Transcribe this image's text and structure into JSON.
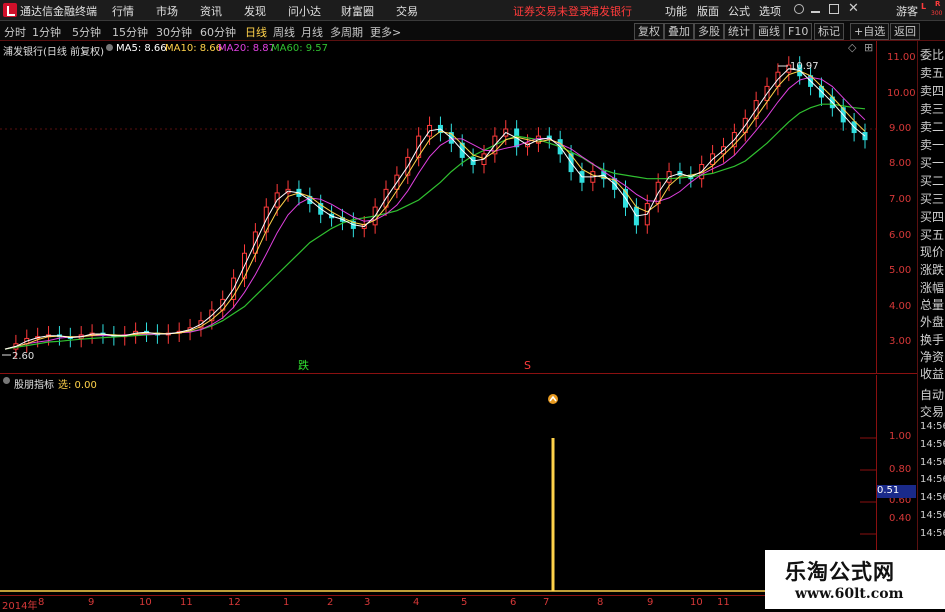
{
  "app": {
    "title": "通达信金融终端"
  },
  "menu": {
    "items": [
      "行情",
      "市场",
      "资讯",
      "发现",
      "问小达",
      "财富圈",
      "交易"
    ]
  },
  "status": {
    "not_logged": "证券交易未登录",
    "stock_name": "浦发银行"
  },
  "right_menu": {
    "items": [
      "功能",
      "版面",
      "公式",
      "选项"
    ],
    "guest": "游客"
  },
  "lr": {
    "l": "L",
    "r": "R",
    "num": "300"
  },
  "periods": {
    "items": [
      "分时",
      "1分钟",
      "5分钟",
      "15分钟",
      "30分钟",
      "60分钟",
      "日线",
      "周线",
      "月线",
      "多周期",
      "更多>"
    ],
    "active": "日线"
  },
  "toolbar": {
    "items": [
      "复权",
      "叠加",
      "多股",
      "统计",
      "画线",
      "F10",
      "标记",
      "+自选",
      "返回"
    ]
  },
  "main_legend": {
    "stock": "浦发银行(日线 前复权)",
    "ma5": "MA5: 8.66",
    "ma10": "MA10: 8.66",
    "ma20": "MA20: 8.87",
    "ma60": "MA60: 9.57"
  },
  "sub_legend": {
    "name": "股朋指标",
    "sel": "选: 0.00"
  },
  "annotations": {
    "high": "10.97",
    "low": "2.60",
    "die": "跌",
    "s": "S"
  },
  "price_axis": [
    "11.00",
    "10.00",
    "9.00",
    "8.00",
    "7.00",
    "6.00",
    "5.00",
    "4.00",
    "3.00"
  ],
  "sub_axis": [
    "1.00",
    "0.80",
    "0.60",
    "0.40"
  ],
  "sub_highlight": "0.51",
  "right_panel": [
    "委比",
    "卖五",
    "卖四",
    "卖三",
    "卖二",
    "卖一",
    "买一",
    "买二",
    "买三",
    "买四",
    "买五",
    "现价",
    "涨跌",
    "涨幅",
    "总量",
    "外盘",
    "换手",
    "净资",
    "收益",
    "自动",
    "交易",
    "14:56",
    "14:56",
    "14:56",
    "14:56",
    "14:56",
    "14:56",
    "14:56"
  ],
  "time_axis": [
    "2014年",
    "8",
    "9",
    "10",
    "11",
    "12",
    "1",
    "2",
    "3",
    "4",
    "5",
    "6",
    "7",
    "8",
    "9",
    "10",
    "11"
  ],
  "watermark": {
    "title": "乐淘公式网",
    "url": "www.60lt.com"
  },
  "colors": {
    "ma5": "#ffffff",
    "ma10": "#ffd24a",
    "ma20": "#e040e0",
    "ma60": "#30c030",
    "up": "#ff3b3b",
    "down": "#30e0e0",
    "axis": "#d63838",
    "signal": "#ffd24a"
  },
  "chart_data": {
    "type": "line",
    "price_range": [
      2.6,
      10.97
    ],
    "close": [
      2.8,
      2.95,
      3.1,
      3.15,
      3.2,
      3.15,
      3.1,
      3.2,
      3.25,
      3.2,
      3.15,
      3.2,
      3.3,
      3.25,
      3.2,
      3.25,
      3.3,
      3.4,
      3.6,
      3.9,
      4.2,
      4.8,
      5.5,
      6.1,
      6.8,
      7.2,
      7.3,
      7.1,
      6.9,
      6.6,
      6.5,
      6.4,
      6.2,
      6.3,
      6.8,
      7.3,
      7.7,
      8.2,
      8.8,
      9.1,
      8.9,
      8.6,
      8.2,
      8.0,
      8.3,
      8.8,
      9.0,
      8.5,
      8.6,
      8.8,
      8.7,
      8.3,
      7.8,
      7.5,
      7.8,
      7.6,
      7.3,
      6.8,
      6.3,
      6.9,
      7.5,
      7.8,
      7.7,
      7.6,
      8.0,
      8.3,
      8.5,
      8.9,
      9.3,
      9.8,
      10.2,
      10.6,
      10.8,
      10.5,
      10.2,
      9.9,
      9.6,
      9.2,
      8.9,
      8.7
    ],
    "ma60": [
      2.8,
      2.85,
      2.9,
      2.95,
      3.0,
      3.02,
      3.05,
      3.08,
      3.1,
      3.12,
      3.14,
      3.16,
      3.18,
      3.2,
      3.22,
      3.24,
      3.26,
      3.3,
      3.35,
      3.45,
      3.6,
      3.8,
      4.0,
      4.3,
      4.6,
      4.9,
      5.2,
      5.5,
      5.8,
      6.0,
      6.2,
      6.35,
      6.45,
      6.5,
      6.55,
      6.62,
      6.7,
      6.85,
      7.0,
      7.25,
      7.5,
      7.8,
      8.05,
      8.25,
      8.4,
      8.55,
      8.7,
      8.8,
      8.75,
      8.7,
      8.6,
      8.5,
      8.35,
      8.2,
      8.0,
      7.85,
      7.75,
      7.7,
      7.65,
      7.6,
      7.6,
      7.6,
      7.62,
      7.65,
      7.7,
      7.75,
      7.85,
      7.95,
      8.1,
      8.35,
      8.6,
      8.9,
      9.2,
      9.45,
      9.6,
      9.7,
      9.7,
      9.65,
      9.6,
      9.57
    ],
    "signal": {
      "range": [
        0,
        1.0
      ],
      "index_fraction": 0.63,
      "value": 1.0
    }
  }
}
